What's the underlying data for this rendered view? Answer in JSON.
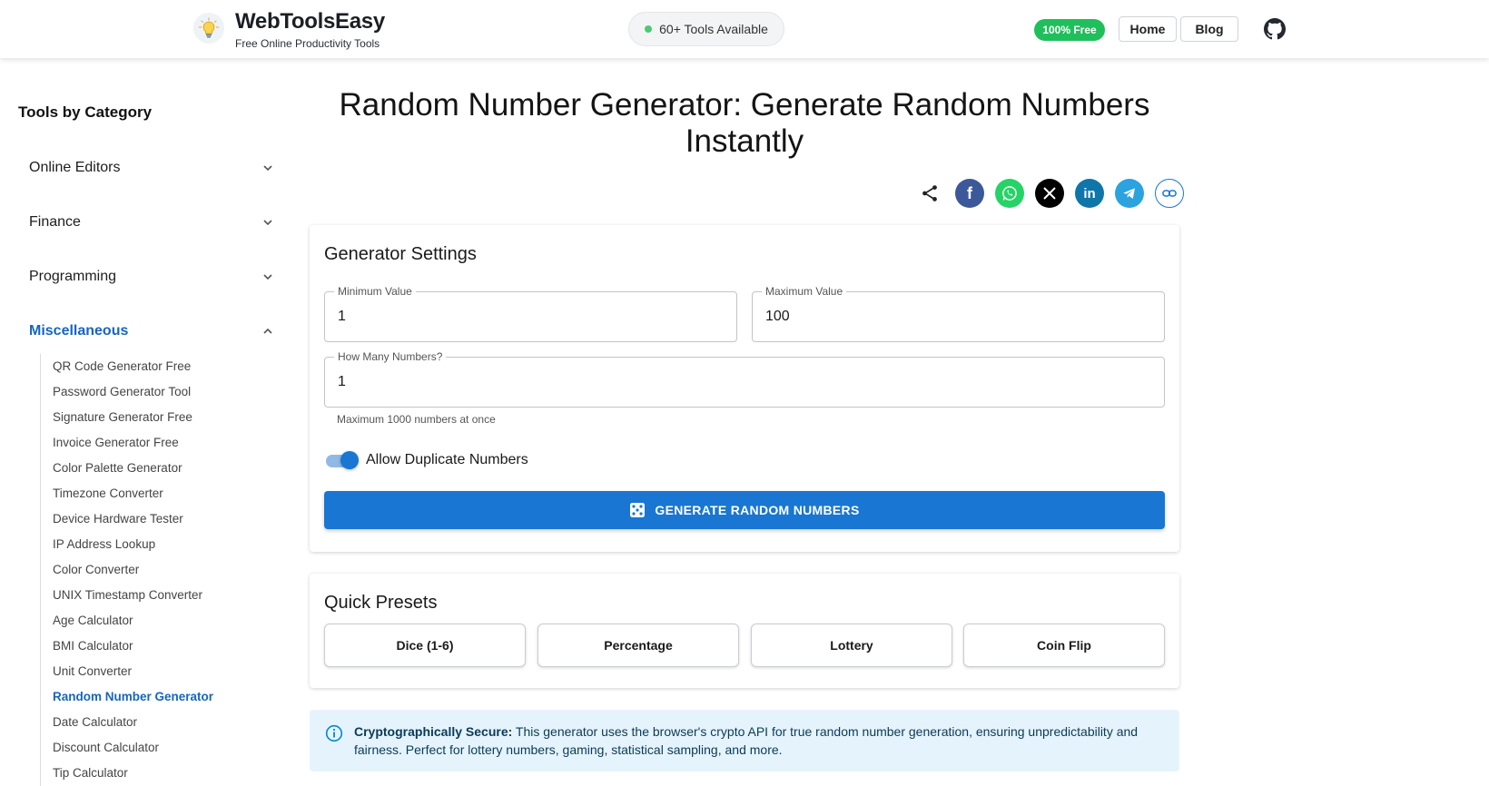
{
  "header": {
    "title": "WebToolsEasy",
    "subtitle": "Free Online Productivity Tools",
    "tools_pill": "60+ Tools Available",
    "free_badge": "100% Free",
    "nav_home": "Home",
    "nav_blog": "Blog",
    "icons": {
      "logo": "lightbulb-icon",
      "github": "github-icon"
    }
  },
  "sidebar": {
    "heading": "Tools by Category",
    "categories": [
      {
        "label": "Online Editors",
        "expanded": false
      },
      {
        "label": "Finance",
        "expanded": false
      },
      {
        "label": "Programming",
        "expanded": false
      },
      {
        "label": "Miscellaneous",
        "expanded": true
      }
    ],
    "sub_items": [
      "QR Code Generator Free",
      "Password Generator Tool",
      "Signature Generator Free",
      "Invoice Generator Free",
      "Color Palette Generator",
      "Timezone Converter",
      "Device Hardware Tester",
      "IP Address Lookup",
      "Color Converter",
      "UNIX Timestamp Converter",
      "Age Calculator",
      "BMI Calculator",
      "Unit Converter",
      "Random Number Generator",
      "Date Calculator",
      "Discount Calculator",
      "Tip Calculator"
    ],
    "active_item": "Random Number Generator"
  },
  "main": {
    "title_line1": "Random Number Generator: Generate Random Numbers",
    "title_line2": "Instantly",
    "share_icons": [
      "share-icon",
      "facebook-icon",
      "whatsapp-icon",
      "x-icon",
      "linkedin-icon",
      "telegram-icon",
      "link-icon"
    ],
    "settings": {
      "title": "Generator Settings",
      "min_label": "Minimum Value",
      "min_value": "1",
      "max_label": "Maximum Value",
      "max_value": "100",
      "count_label": "How Many Numbers?",
      "count_value": "1",
      "helper": "Maximum 1000 numbers at once",
      "duplicates_label": "Allow Duplicate Numbers",
      "duplicates_enabled": true,
      "generate_label": "GENERATE RANDOM NUMBERS"
    },
    "presets": {
      "title": "Quick Presets",
      "items": [
        "Dice (1-6)",
        "Percentage",
        "Lottery",
        "Coin Flip"
      ]
    },
    "info": {
      "bold": "Cryptographically Secure:",
      "text": " This generator uses the browser's crypto API for true random number generation, ensuring unpredictability and fairness. Perfect for lottery numbers, gaming, statistical sampling, and more."
    }
  },
  "colors": {
    "accent": "#1976d2",
    "active_link": "#1565c0",
    "free_badge": "#1fbf5b",
    "info_bg": "#e5f4fc"
  }
}
